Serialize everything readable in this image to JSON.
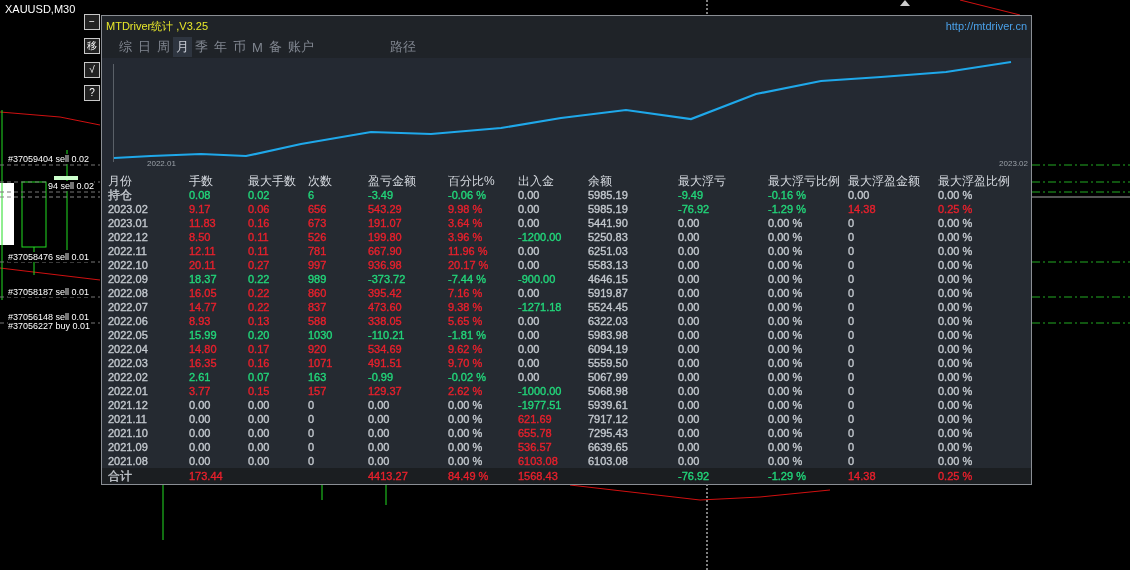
{
  "chart_window": {
    "symbol": "XAUUSD,M30",
    "side_buttons": [
      {
        "label": "−"
      },
      {
        "label": "移"
      },
      {
        "label": "√"
      },
      {
        "label": "?"
      }
    ],
    "order_labels": [
      "#37059404 sell 0.02",
      "94 sell 0.02",
      "#37058476 sell 0.01",
      "#37058187 sell 0.01",
      "#37056148 sell 0.01",
      "#37056227 buy 0.01"
    ]
  },
  "panel": {
    "title": "MTDriver统计 ,V3.25",
    "link": "http://mtdriver.cn",
    "tabs": [
      {
        "label": "综",
        "selected": false
      },
      {
        "label": "日",
        "selected": false
      },
      {
        "label": "周",
        "selected": false
      },
      {
        "label": "月",
        "selected": true
      },
      {
        "label": "季",
        "selected": false
      },
      {
        "label": "年",
        "selected": false
      },
      {
        "label": "币",
        "selected": false
      },
      {
        "label": "M",
        "selected": false
      },
      {
        "label": "备",
        "selected": false
      },
      {
        "label": "账户",
        "selected": false
      },
      {
        "label": "路径",
        "selected": false
      }
    ],
    "equity_chart": {
      "start_label": "2022.01",
      "end_label": "2023.02"
    },
    "table": {
      "columns": [
        "月份",
        "手数",
        "最大手数",
        "次数",
        "盈亏金额",
        "百分比%",
        "出入金",
        "余额",
        "最大浮亏",
        "最大浮亏比例",
        "最大浮盈金额",
        "最大浮盈比例"
      ],
      "rows": [
        [
          {
            "text": "持仓",
            "color": "#c3c8ce"
          },
          {
            "text": "0.08",
            "color": "#22d67a"
          },
          {
            "text": "0.02",
            "color": "#22d67a"
          },
          {
            "text": "6",
            "color": "#22d67a"
          },
          {
            "text": "-3.49",
            "color": "#22d67a"
          },
          {
            "text": "-0.06 %",
            "color": "#22d67a"
          },
          {
            "text": "0.00",
            "color": "#c3c8ce"
          },
          {
            "text": "5985.19",
            "color": "#c3c8ce"
          },
          {
            "text": "-9.49",
            "color": "#22d67a"
          },
          {
            "text": "-0.16 %",
            "color": "#22d67a"
          },
          {
            "text": "0.00",
            "color": "#c3c8ce"
          },
          {
            "text": "0.00 %",
            "color": "#c3c8ce"
          }
        ],
        [
          {
            "text": "2023.02",
            "color": "#c3c8ce"
          },
          {
            "text": "9.17",
            "color": "#e8202c"
          },
          {
            "text": "0.06",
            "color": "#e8202c"
          },
          {
            "text": "656",
            "color": "#e8202c"
          },
          {
            "text": "543.29",
            "color": "#e8202c"
          },
          {
            "text": "9.98 %",
            "color": "#e8202c"
          },
          {
            "text": "0.00",
            "color": "#c3c8ce"
          },
          {
            "text": "5985.19",
            "color": "#c3c8ce"
          },
          {
            "text": "-76.92",
            "color": "#22d67a"
          },
          {
            "text": "-1.29 %",
            "color": "#22d67a"
          },
          {
            "text": "14.38",
            "color": "#e8202c"
          },
          {
            "text": "0.25 %",
            "color": "#e8202c"
          }
        ],
        [
          {
            "text": "2023.01",
            "color": "#c3c8ce"
          },
          {
            "text": "11.83",
            "color": "#e8202c"
          },
          {
            "text": "0.16",
            "color": "#e8202c"
          },
          {
            "text": "673",
            "color": "#e8202c"
          },
          {
            "text": "191.07",
            "color": "#e8202c"
          },
          {
            "text": "3.64 %",
            "color": "#e8202c"
          },
          {
            "text": "0.00",
            "color": "#c3c8ce"
          },
          {
            "text": "5441.90",
            "color": "#c3c8ce"
          },
          {
            "text": "0.00",
            "color": "#c3c8ce"
          },
          {
            "text": "0.00 %",
            "color": "#c3c8ce"
          },
          {
            "text": "0",
            "color": "#c3c8ce"
          },
          {
            "text": "0.00 %",
            "color": "#c3c8ce"
          }
        ],
        [
          {
            "text": "2022.12",
            "color": "#c3c8ce"
          },
          {
            "text": "8.50",
            "color": "#e8202c"
          },
          {
            "text": "0.11",
            "color": "#e8202c"
          },
          {
            "text": "526",
            "color": "#e8202c"
          },
          {
            "text": "199.80",
            "color": "#e8202c"
          },
          {
            "text": "3.96 %",
            "color": "#e8202c"
          },
          {
            "text": "-1200.00",
            "color": "#22d67a"
          },
          {
            "text": "5250.83",
            "color": "#c3c8ce"
          },
          {
            "text": "0.00",
            "color": "#c3c8ce"
          },
          {
            "text": "0.00 %",
            "color": "#c3c8ce"
          },
          {
            "text": "0",
            "color": "#c3c8ce"
          },
          {
            "text": "0.00 %",
            "color": "#c3c8ce"
          }
        ],
        [
          {
            "text": "2022.11",
            "color": "#c3c8ce"
          },
          {
            "text": "12.11",
            "color": "#e8202c"
          },
          {
            "text": "0.11",
            "color": "#e8202c"
          },
          {
            "text": "781",
            "color": "#e8202c"
          },
          {
            "text": "667.90",
            "color": "#e8202c"
          },
          {
            "text": "11.96 %",
            "color": "#e8202c"
          },
          {
            "text": "0.00",
            "color": "#c3c8ce"
          },
          {
            "text": "6251.03",
            "color": "#c3c8ce"
          },
          {
            "text": "0.00",
            "color": "#c3c8ce"
          },
          {
            "text": "0.00 %",
            "color": "#c3c8ce"
          },
          {
            "text": "0",
            "color": "#c3c8ce"
          },
          {
            "text": "0.00 %",
            "color": "#c3c8ce"
          }
        ],
        [
          {
            "text": "2022.10",
            "color": "#c3c8ce"
          },
          {
            "text": "20.11",
            "color": "#e8202c"
          },
          {
            "text": "0.27",
            "color": "#e8202c"
          },
          {
            "text": "997",
            "color": "#e8202c"
          },
          {
            "text": "936.98",
            "color": "#e8202c"
          },
          {
            "text": "20.17 %",
            "color": "#e8202c"
          },
          {
            "text": "0.00",
            "color": "#c3c8ce"
          },
          {
            "text": "5583.13",
            "color": "#c3c8ce"
          },
          {
            "text": "0.00",
            "color": "#c3c8ce"
          },
          {
            "text": "0.00 %",
            "color": "#c3c8ce"
          },
          {
            "text": "0",
            "color": "#c3c8ce"
          },
          {
            "text": "0.00 %",
            "color": "#c3c8ce"
          }
        ],
        [
          {
            "text": "2022.09",
            "color": "#c3c8ce"
          },
          {
            "text": "18.37",
            "color": "#22d67a"
          },
          {
            "text": "0.22",
            "color": "#22d67a"
          },
          {
            "text": "989",
            "color": "#22d67a"
          },
          {
            "text": "-373.72",
            "color": "#22d67a"
          },
          {
            "text": "-7.44 %",
            "color": "#22d67a"
          },
          {
            "text": "-900.00",
            "color": "#22d67a"
          },
          {
            "text": "4646.15",
            "color": "#c3c8ce"
          },
          {
            "text": "0.00",
            "color": "#c3c8ce"
          },
          {
            "text": "0.00 %",
            "color": "#c3c8ce"
          },
          {
            "text": "0",
            "color": "#c3c8ce"
          },
          {
            "text": "0.00 %",
            "color": "#c3c8ce"
          }
        ],
        [
          {
            "text": "2022.08",
            "color": "#c3c8ce"
          },
          {
            "text": "16.05",
            "color": "#e8202c"
          },
          {
            "text": "0.22",
            "color": "#e8202c"
          },
          {
            "text": "860",
            "color": "#e8202c"
          },
          {
            "text": "395.42",
            "color": "#e8202c"
          },
          {
            "text": "7.16 %",
            "color": "#e8202c"
          },
          {
            "text": "0.00",
            "color": "#c3c8ce"
          },
          {
            "text": "5919.87",
            "color": "#c3c8ce"
          },
          {
            "text": "0.00",
            "color": "#c3c8ce"
          },
          {
            "text": "0.00 %",
            "color": "#c3c8ce"
          },
          {
            "text": "0",
            "color": "#c3c8ce"
          },
          {
            "text": "0.00 %",
            "color": "#c3c8ce"
          }
        ],
        [
          {
            "text": "2022.07",
            "color": "#c3c8ce"
          },
          {
            "text": "14.77",
            "color": "#e8202c"
          },
          {
            "text": "0.22",
            "color": "#e8202c"
          },
          {
            "text": "837",
            "color": "#e8202c"
          },
          {
            "text": "473.60",
            "color": "#e8202c"
          },
          {
            "text": "9.38 %",
            "color": "#e8202c"
          },
          {
            "text": "-1271.18",
            "color": "#22d67a"
          },
          {
            "text": "5524.45",
            "color": "#c3c8ce"
          },
          {
            "text": "0.00",
            "color": "#c3c8ce"
          },
          {
            "text": "0.00 %",
            "color": "#c3c8ce"
          },
          {
            "text": "0",
            "color": "#c3c8ce"
          },
          {
            "text": "0.00 %",
            "color": "#c3c8ce"
          }
        ],
        [
          {
            "text": "2022.06",
            "color": "#c3c8ce"
          },
          {
            "text": "8.93",
            "color": "#e8202c"
          },
          {
            "text": "0.13",
            "color": "#e8202c"
          },
          {
            "text": "588",
            "color": "#e8202c"
          },
          {
            "text": "338.05",
            "color": "#e8202c"
          },
          {
            "text": "5.65 %",
            "color": "#e8202c"
          },
          {
            "text": "0.00",
            "color": "#c3c8ce"
          },
          {
            "text": "6322.03",
            "color": "#c3c8ce"
          },
          {
            "text": "0.00",
            "color": "#c3c8ce"
          },
          {
            "text": "0.00 %",
            "color": "#c3c8ce"
          },
          {
            "text": "0",
            "color": "#c3c8ce"
          },
          {
            "text": "0.00 %",
            "color": "#c3c8ce"
          }
        ],
        [
          {
            "text": "2022.05",
            "color": "#c3c8ce"
          },
          {
            "text": "15.99",
            "color": "#22d67a"
          },
          {
            "text": "0.20",
            "color": "#22d67a"
          },
          {
            "text": "1030",
            "color": "#22d67a"
          },
          {
            "text": "-110.21",
            "color": "#22d67a"
          },
          {
            "text": "-1.81 %",
            "color": "#22d67a"
          },
          {
            "text": "0.00",
            "color": "#c3c8ce"
          },
          {
            "text": "5983.98",
            "color": "#c3c8ce"
          },
          {
            "text": "0.00",
            "color": "#c3c8ce"
          },
          {
            "text": "0.00 %",
            "color": "#c3c8ce"
          },
          {
            "text": "0",
            "color": "#c3c8ce"
          },
          {
            "text": "0.00 %",
            "color": "#c3c8ce"
          }
        ],
        [
          {
            "text": "2022.04",
            "color": "#c3c8ce"
          },
          {
            "text": "14.80",
            "color": "#e8202c"
          },
          {
            "text": "0.17",
            "color": "#e8202c"
          },
          {
            "text": "920",
            "color": "#e8202c"
          },
          {
            "text": "534.69",
            "color": "#e8202c"
          },
          {
            "text": "9.62 %",
            "color": "#e8202c"
          },
          {
            "text": "0.00",
            "color": "#c3c8ce"
          },
          {
            "text": "6094.19",
            "color": "#c3c8ce"
          },
          {
            "text": "0.00",
            "color": "#c3c8ce"
          },
          {
            "text": "0.00 %",
            "color": "#c3c8ce"
          },
          {
            "text": "0",
            "color": "#c3c8ce"
          },
          {
            "text": "0.00 %",
            "color": "#c3c8ce"
          }
        ],
        [
          {
            "text": "2022.03",
            "color": "#c3c8ce"
          },
          {
            "text": "16.35",
            "color": "#e8202c"
          },
          {
            "text": "0.16",
            "color": "#e8202c"
          },
          {
            "text": "1071",
            "color": "#e8202c"
          },
          {
            "text": "491.51",
            "color": "#e8202c"
          },
          {
            "text": "9.70 %",
            "color": "#e8202c"
          },
          {
            "text": "0.00",
            "color": "#c3c8ce"
          },
          {
            "text": "5559.50",
            "color": "#c3c8ce"
          },
          {
            "text": "0.00",
            "color": "#c3c8ce"
          },
          {
            "text": "0.00 %",
            "color": "#c3c8ce"
          },
          {
            "text": "0",
            "color": "#c3c8ce"
          },
          {
            "text": "0.00 %",
            "color": "#c3c8ce"
          }
        ],
        [
          {
            "text": "2022.02",
            "color": "#c3c8ce"
          },
          {
            "text": "2.61",
            "color": "#22d67a"
          },
          {
            "text": "0.07",
            "color": "#22d67a"
          },
          {
            "text": "163",
            "color": "#22d67a"
          },
          {
            "text": "-0.99",
            "color": "#22d67a"
          },
          {
            "text": "-0.02 %",
            "color": "#22d67a"
          },
          {
            "text": "0.00",
            "color": "#c3c8ce"
          },
          {
            "text": "5067.99",
            "color": "#c3c8ce"
          },
          {
            "text": "0.00",
            "color": "#c3c8ce"
          },
          {
            "text": "0.00 %",
            "color": "#c3c8ce"
          },
          {
            "text": "0",
            "color": "#c3c8ce"
          },
          {
            "text": "0.00 %",
            "color": "#c3c8ce"
          }
        ],
        [
          {
            "text": "2022.01",
            "color": "#c3c8ce"
          },
          {
            "text": "3.77",
            "color": "#e8202c"
          },
          {
            "text": "0.15",
            "color": "#e8202c"
          },
          {
            "text": "157",
            "color": "#e8202c"
          },
          {
            "text": "129.37",
            "color": "#e8202c"
          },
          {
            "text": "2.62 %",
            "color": "#e8202c"
          },
          {
            "text": "-1000.00",
            "color": "#22d67a"
          },
          {
            "text": "5068.98",
            "color": "#c3c8ce"
          },
          {
            "text": "0.00",
            "color": "#c3c8ce"
          },
          {
            "text": "0.00 %",
            "color": "#c3c8ce"
          },
          {
            "text": "0",
            "color": "#c3c8ce"
          },
          {
            "text": "0.00 %",
            "color": "#c3c8ce"
          }
        ],
        [
          {
            "text": "2021.12",
            "color": "#c3c8ce"
          },
          {
            "text": "0.00",
            "color": "#c3c8ce"
          },
          {
            "text": "0.00",
            "color": "#c3c8ce"
          },
          {
            "text": "0",
            "color": "#c3c8ce"
          },
          {
            "text": "0.00",
            "color": "#c3c8ce"
          },
          {
            "text": "0.00 %",
            "color": "#c3c8ce"
          },
          {
            "text": "-1977.51",
            "color": "#22d67a"
          },
          {
            "text": "5939.61",
            "color": "#c3c8ce"
          },
          {
            "text": "0.00",
            "color": "#c3c8ce"
          },
          {
            "text": "0.00 %",
            "color": "#c3c8ce"
          },
          {
            "text": "0",
            "color": "#c3c8ce"
          },
          {
            "text": "0.00 %",
            "color": "#c3c8ce"
          }
        ],
        [
          {
            "text": "2021.11",
            "color": "#c3c8ce"
          },
          {
            "text": "0.00",
            "color": "#c3c8ce"
          },
          {
            "text": "0.00",
            "color": "#c3c8ce"
          },
          {
            "text": "0",
            "color": "#c3c8ce"
          },
          {
            "text": "0.00",
            "color": "#c3c8ce"
          },
          {
            "text": "0.00 %",
            "color": "#c3c8ce"
          },
          {
            "text": "621.69",
            "color": "#e8202c"
          },
          {
            "text": "7917.12",
            "color": "#c3c8ce"
          },
          {
            "text": "0.00",
            "color": "#c3c8ce"
          },
          {
            "text": "0.00 %",
            "color": "#c3c8ce"
          },
          {
            "text": "0",
            "color": "#c3c8ce"
          },
          {
            "text": "0.00 %",
            "color": "#c3c8ce"
          }
        ],
        [
          {
            "text": "2021.10",
            "color": "#c3c8ce"
          },
          {
            "text": "0.00",
            "color": "#c3c8ce"
          },
          {
            "text": "0.00",
            "color": "#c3c8ce"
          },
          {
            "text": "0",
            "color": "#c3c8ce"
          },
          {
            "text": "0.00",
            "color": "#c3c8ce"
          },
          {
            "text": "0.00 %",
            "color": "#c3c8ce"
          },
          {
            "text": "655.78",
            "color": "#e8202c"
          },
          {
            "text": "7295.43",
            "color": "#c3c8ce"
          },
          {
            "text": "0.00",
            "color": "#c3c8ce"
          },
          {
            "text": "0.00 %",
            "color": "#c3c8ce"
          },
          {
            "text": "0",
            "color": "#c3c8ce"
          },
          {
            "text": "0.00 %",
            "color": "#c3c8ce"
          }
        ],
        [
          {
            "text": "2021.09",
            "color": "#c3c8ce"
          },
          {
            "text": "0.00",
            "color": "#c3c8ce"
          },
          {
            "text": "0.00",
            "color": "#c3c8ce"
          },
          {
            "text": "0",
            "color": "#c3c8ce"
          },
          {
            "text": "0.00",
            "color": "#c3c8ce"
          },
          {
            "text": "0.00 %",
            "color": "#c3c8ce"
          },
          {
            "text": "536.57",
            "color": "#e8202c"
          },
          {
            "text": "6639.65",
            "color": "#c3c8ce"
          },
          {
            "text": "0.00",
            "color": "#c3c8ce"
          },
          {
            "text": "0.00 %",
            "color": "#c3c8ce"
          },
          {
            "text": "0",
            "color": "#c3c8ce"
          },
          {
            "text": "0.00 %",
            "color": "#c3c8ce"
          }
        ],
        [
          {
            "text": "2021.08",
            "color": "#c3c8ce"
          },
          {
            "text": "0.00",
            "color": "#c3c8ce"
          },
          {
            "text": "0.00",
            "color": "#c3c8ce"
          },
          {
            "text": "0",
            "color": "#c3c8ce"
          },
          {
            "text": "0.00",
            "color": "#c3c8ce"
          },
          {
            "text": "0.00 %",
            "color": "#c3c8ce"
          },
          {
            "text": "6103.08",
            "color": "#e8202c"
          },
          {
            "text": "6103.08",
            "color": "#c3c8ce"
          },
          {
            "text": "0.00",
            "color": "#c3c8ce"
          },
          {
            "text": "0.00 %",
            "color": "#c3c8ce"
          },
          {
            "text": "0",
            "color": "#c3c8ce"
          },
          {
            "text": "0.00 %",
            "color": "#c3c8ce"
          }
        ]
      ],
      "total_row": {
        "month": {
          "text": "合计",
          "color": "#c3c8ce"
        },
        "lots": {
          "text": "173.44",
          "color": "#e8202c"
        },
        "pnl": {
          "text": "4413.27",
          "color": "#e8202c"
        },
        "percent": {
          "text": "84.49 %",
          "color": "#e8202c"
        },
        "deposit": {
          "text": "1568.43",
          "color": "#e8202c"
        },
        "max_float_loss": {
          "text": "-76.92",
          "color": "#22d67a"
        },
        "max_float_loss_ratio": {
          "text": "-1.29 %",
          "color": "#22d67a"
        },
        "max_float_profit": {
          "text": "14.38",
          "color": "#e8202c"
        },
        "max_float_profit_ratio": {
          "text": "0.25 %",
          "color": "#e8202c"
        }
      }
    }
  }
}
